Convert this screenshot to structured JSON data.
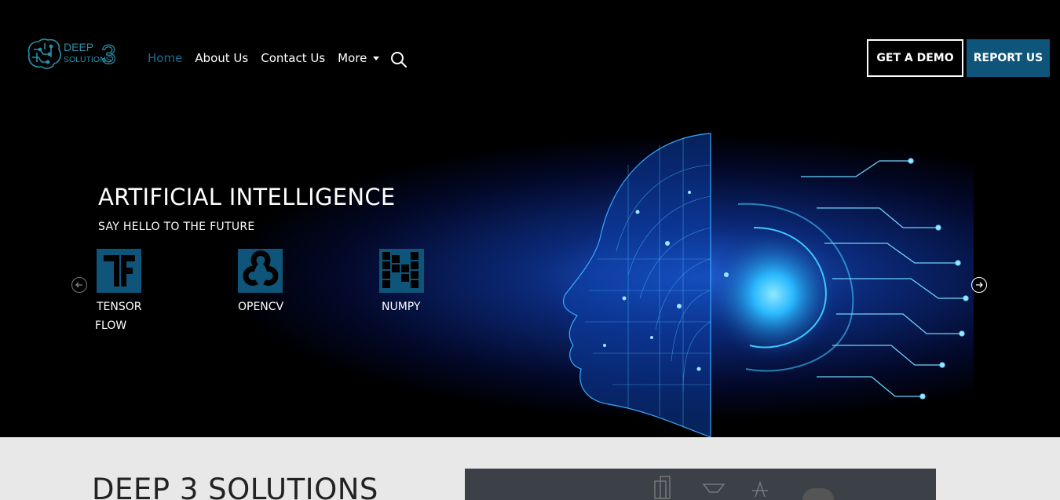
{
  "brand": {
    "logo_line1": "DEEP",
    "logo_line2": "SOLUTIONS",
    "logo_number": "3",
    "accent": "#0e5579",
    "nav_active": "#1b6f99"
  },
  "nav": {
    "items": [
      {
        "label": "Home",
        "active": true
      },
      {
        "label": "About Us"
      },
      {
        "label": "Contact Us"
      },
      {
        "label": "More"
      }
    ],
    "search_icon": "search-icon"
  },
  "cta": {
    "demo_label": "GET A DEMO",
    "report_label": "REPORT US"
  },
  "hero": {
    "title": "ARTIFICIAL INTELLIGENCE",
    "subtitle": "SAY HELLO TO THE FUTURE",
    "technologies": [
      {
        "line1": "TENSOR",
        "line2": "FLOW",
        "icon": "tensorflow-icon"
      },
      {
        "line1": "OPENCV",
        "line2": "",
        "icon": "opencv-icon"
      },
      {
        "line1": "NUMPY",
        "line2": "",
        "icon": "numpy-icon"
      }
    ],
    "prev_icon": "arrow-left-icon",
    "next_icon": "arrow-right-icon"
  },
  "about": {
    "title": "DEEP 3 SOLUTIONS"
  }
}
